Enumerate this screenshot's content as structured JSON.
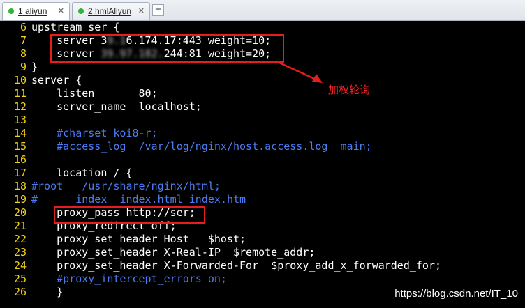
{
  "tabs": [
    {
      "index": "1",
      "title": "aliyun",
      "active": true
    },
    {
      "index": "2",
      "title": "hmlAliyun",
      "active": false
    }
  ],
  "tab_close_glyph": "✕",
  "new_tab_glyph": "+",
  "colors": {
    "line_number": "#f2d21a",
    "comment": "#4c7cf0",
    "highlight_box": "#e41e1e",
    "annotation": "#ff2626",
    "tab_status_dot": "#2fb53a"
  },
  "lines": [
    {
      "num": "6",
      "text": "upstream ser {"
    },
    {
      "num": "7",
      "pre": "    server 3",
      "blurred": "9.1",
      "post": "6.174.17:443 weight=10;"
    },
    {
      "num": "8",
      "pre": "    server ",
      "blurred": "39.97.182.",
      "post": "244:81 weight=20;"
    },
    {
      "num": "9",
      "text": "}"
    },
    {
      "num": "10",
      "text": "server {"
    },
    {
      "num": "11",
      "text": "    listen       80;"
    },
    {
      "num": "12",
      "text": "    server_name  localhost;"
    },
    {
      "num": "13",
      "text": ""
    },
    {
      "num": "14",
      "text": "    #charset koi8-r;",
      "comment": true
    },
    {
      "num": "15",
      "text": "    #access_log  /var/log/nginx/host.access.log  main;",
      "comment": true
    },
    {
      "num": "16",
      "text": ""
    },
    {
      "num": "17",
      "text": "    location / {"
    },
    {
      "num": "18",
      "text": "#root   /usr/share/nginx/html;",
      "comment": true
    },
    {
      "num": "19",
      "text": "#      index  index.html index.htm",
      "comment": true
    },
    {
      "num": "20",
      "text": "    proxy_pass http://ser;"
    },
    {
      "num": "21",
      "text": "    proxy_redirect off;"
    },
    {
      "num": "22",
      "text": "    proxy_set_header Host   $host;"
    },
    {
      "num": "23",
      "text": "    proxy_set_header X-Real-IP  $remote_addr;"
    },
    {
      "num": "24",
      "text": "    proxy_set_header X-Forwarded-For  $proxy_add_x_forwarded_for;"
    },
    {
      "num": "25",
      "text": "    #proxy_intercept_errors on;",
      "comment": true
    },
    {
      "num": "26",
      "text": "    }"
    }
  ],
  "annotation": "加权轮询",
  "watermark": "https://blog.csdn.net/IT_10"
}
